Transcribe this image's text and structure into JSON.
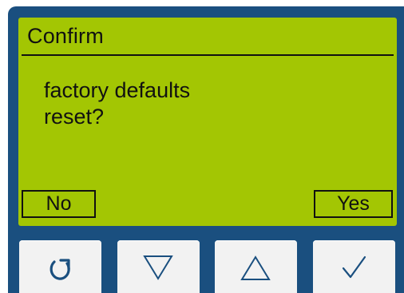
{
  "screen": {
    "title": "Confirm",
    "message_line1": "factory defaults",
    "message_line2": "reset?"
  },
  "softkeys": {
    "left_label": "No",
    "right_label": "Yes"
  },
  "buttons": [
    {
      "icon": "back-arrow-icon"
    },
    {
      "icon": "triangle-down-icon"
    },
    {
      "icon": "triangle-up-icon"
    },
    {
      "icon": "checkmark-icon"
    }
  ],
  "colors": {
    "bezel": "#1a4f7f",
    "screen": "#a3c603",
    "text": "#111111",
    "button": "#f2f2f2"
  }
}
